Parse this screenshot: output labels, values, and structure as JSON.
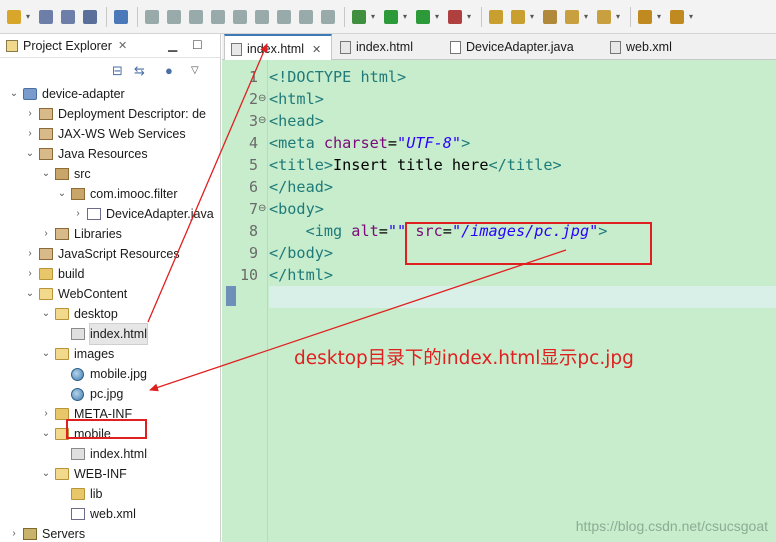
{
  "toolbar": {
    "buttons": [
      "new-icon",
      "save-icon",
      "save-all-icon",
      "print-icon",
      "skip-breakpoints-icon",
      "resume-icon",
      "suspend-icon",
      "terminate-icon",
      "disconnect-icon",
      "step-into-icon",
      "step-over-icon",
      "step-return-icon",
      "use-step-filters-icon",
      "drop-to-frame-icon",
      "debug-icon",
      "run-icon",
      "coverage-icon",
      "external-tools-icon",
      "open-type-icon",
      "open-task-icon",
      "search-icon",
      "next-annotation-icon",
      "previous-annotation-icon",
      "back-icon",
      "forward-icon"
    ]
  },
  "explorer": {
    "title": "Project Explorer",
    "close_glyph": "✕",
    "tree": [
      {
        "label": "device-adapter",
        "icon": "project-icon",
        "depth": 0,
        "expand": "open"
      },
      {
        "label": "Deployment Descriptor: de",
        "icon": "deployment-descriptor-icon",
        "depth": 1,
        "expand": "closed"
      },
      {
        "label": "JAX-WS Web Services",
        "icon": "web-services-icon",
        "depth": 1,
        "expand": "closed"
      },
      {
        "label": "Java Resources",
        "icon": "java-resources-icon",
        "depth": 1,
        "expand": "open"
      },
      {
        "label": "src",
        "icon": "source-folder-icon",
        "depth": 2,
        "expand": "open"
      },
      {
        "label": "com.imooc.filter",
        "icon": "package-icon",
        "depth": 3,
        "expand": "open"
      },
      {
        "label": "DeviceAdapter.java",
        "icon": "java-file-icon",
        "depth": 4,
        "expand": "closed"
      },
      {
        "label": "Libraries",
        "icon": "libraries-icon",
        "depth": 2,
        "expand": "closed"
      },
      {
        "label": "JavaScript Resources",
        "icon": "javascript-resources-icon",
        "depth": 1,
        "expand": "closed"
      },
      {
        "label": "build",
        "icon": "folder-icon",
        "depth": 1,
        "expand": "closed"
      },
      {
        "label": "WebContent",
        "icon": "folder-icon",
        "depth": 1,
        "expand": "open"
      },
      {
        "label": "desktop",
        "icon": "folder-icon",
        "depth": 2,
        "expand": "open"
      },
      {
        "label": "index.html",
        "icon": "html-file-icon",
        "depth": 3,
        "expand": "none",
        "selected": true
      },
      {
        "label": "images",
        "icon": "folder-icon",
        "depth": 2,
        "expand": "open"
      },
      {
        "label": "mobile.jpg",
        "icon": "image-file-icon",
        "depth": 3,
        "expand": "none"
      },
      {
        "label": "pc.jpg",
        "icon": "image-file-icon",
        "depth": 3,
        "expand": "none"
      },
      {
        "label": "META-INF",
        "icon": "folder-icon",
        "depth": 2,
        "expand": "closed"
      },
      {
        "label": "mobile",
        "icon": "folder-icon",
        "depth": 2,
        "expand": "open"
      },
      {
        "label": "index.html",
        "icon": "html-file-icon",
        "depth": 3,
        "expand": "none"
      },
      {
        "label": "WEB-INF",
        "icon": "folder-icon",
        "depth": 2,
        "expand": "open"
      },
      {
        "label": "lib",
        "icon": "folder-icon",
        "depth": 3,
        "expand": "none"
      },
      {
        "label": "web.xml",
        "icon": "xml-file-icon",
        "depth": 3,
        "expand": "none"
      },
      {
        "label": "Servers",
        "icon": "servers-icon",
        "depth": 0,
        "expand": "closed"
      }
    ]
  },
  "editor": {
    "tabs": [
      {
        "label": "index.html",
        "icon": "html-file-icon",
        "active": true,
        "close_glyph": "✕"
      },
      {
        "label": "index.html",
        "icon": "html-file-icon",
        "active": false
      },
      {
        "label": "DeviceAdapter.java",
        "icon": "java-file-icon",
        "active": false
      },
      {
        "label": "web.xml",
        "icon": "xml-file-icon",
        "active": false
      }
    ],
    "line_numbers": [
      "1",
      "2",
      "3",
      "4",
      "5",
      "6",
      "7",
      "8",
      "9",
      "10"
    ],
    "fold_markers": [
      "",
      "⊖",
      "⊖",
      "",
      "",
      "",
      "⊖",
      "",
      "",
      ""
    ],
    "lines": [
      [
        {
          "t": "<!DOCTYPE ",
          "c": "tag"
        },
        {
          "t": "html",
          "c": "tag"
        },
        {
          "t": ">",
          "c": "tag"
        }
      ],
      [
        {
          "t": "<html>",
          "c": "tag"
        }
      ],
      [
        {
          "t": "<head>",
          "c": "tag"
        }
      ],
      [
        {
          "t": "<meta ",
          "c": "tag"
        },
        {
          "t": "charset",
          "c": "attr"
        },
        {
          "t": "=",
          "c": ""
        },
        {
          "t": "\"UTF-8\"",
          "c": "val"
        },
        {
          "t": ">",
          "c": "tag"
        }
      ],
      [
        {
          "t": "<title>",
          "c": "tag"
        },
        {
          "t": "Insert title here",
          "c": ""
        },
        {
          "t": "</title>",
          "c": "tag"
        }
      ],
      [
        {
          "t": "</head>",
          "c": "tag"
        }
      ],
      [
        {
          "t": "<body>",
          "c": "tag"
        }
      ],
      [
        {
          "t": "    ",
          "c": ""
        },
        {
          "t": "<img ",
          "c": "tag"
        },
        {
          "t": "alt",
          "c": "attr"
        },
        {
          "t": "=",
          "c": ""
        },
        {
          "t": "\"\"",
          "c": "val"
        },
        {
          "t": " ",
          "c": ""
        },
        {
          "t": "src",
          "c": "attr"
        },
        {
          "t": "=",
          "c": ""
        },
        {
          "t": "\"/images/pc.jpg\"",
          "c": "val"
        },
        {
          "t": ">",
          "c": "tag"
        }
      ],
      [
        {
          "t": "</body>",
          "c": "tag"
        }
      ],
      [
        {
          "t": "</html>",
          "c": "tag"
        }
      ]
    ],
    "annotation_text": "desktop目录下的index.html显示pc.jpg",
    "watermark": "https://blog.csdn.net/csucsgoat"
  },
  "colors": {
    "editor_background": "#c7edcc",
    "annotation": "#e02020",
    "tag": "#1f7a7a",
    "attribute": "#7a0a7a",
    "string_value": "#2a00ff"
  }
}
